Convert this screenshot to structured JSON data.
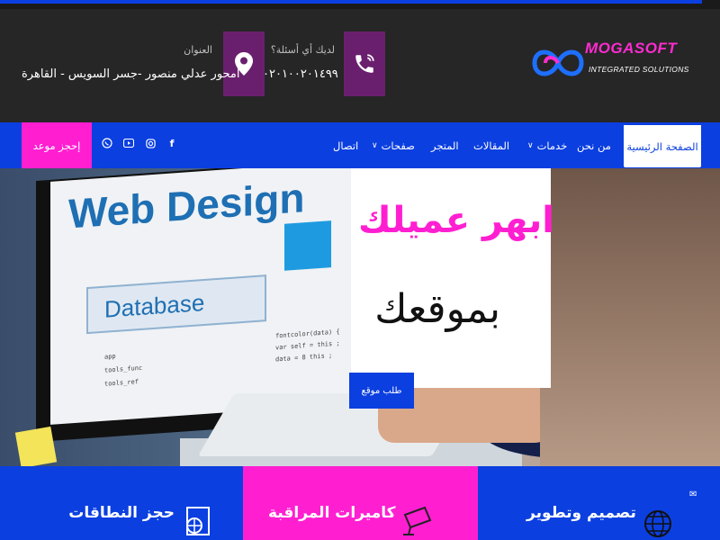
{
  "brand": {
    "name": "MOGASOFT",
    "tagline": "INTEGRATED SOLUTIONS"
  },
  "contact": {
    "question_label": "لديك أي أسئلة؟",
    "phone": "٠٢٠١٠٠٢٠١٤٩٩",
    "address_label": "العنوان",
    "address": "امحور عدلي منصور -جسر السويس - القاهرة"
  },
  "nav": {
    "items": [
      {
        "label": "الصفحة الرئيسية",
        "active": true
      },
      {
        "label": "من نحن"
      },
      {
        "label": "خدمات",
        "dropdown": true
      },
      {
        "label": "المقالات"
      },
      {
        "label": "المتجر"
      },
      {
        "label": "صفحات",
        "dropdown": true
      },
      {
        "label": "اتصال"
      }
    ],
    "book_button": "إحجز موعد",
    "social_icons": [
      "facebook-icon",
      "instagram-icon",
      "youtube-icon",
      "whatsapp-icon"
    ]
  },
  "hero": {
    "title": "ابهر عميلك",
    "subtitle": "بموقعك",
    "button": "طلب موقع",
    "screen_heading": "Web Design",
    "screen_box": "Database"
  },
  "services": [
    {
      "title": "تصميم وتطوير"
    },
    {
      "title": "كاميرات المراقبة"
    },
    {
      "title": "حجز النطاقات"
    }
  ],
  "colors": {
    "primary_blue": "#0b3fe0",
    "accent_pink": "#ff1fd1",
    "header_bg": "#262626",
    "icon_box_purple": "#6a1f6e"
  }
}
